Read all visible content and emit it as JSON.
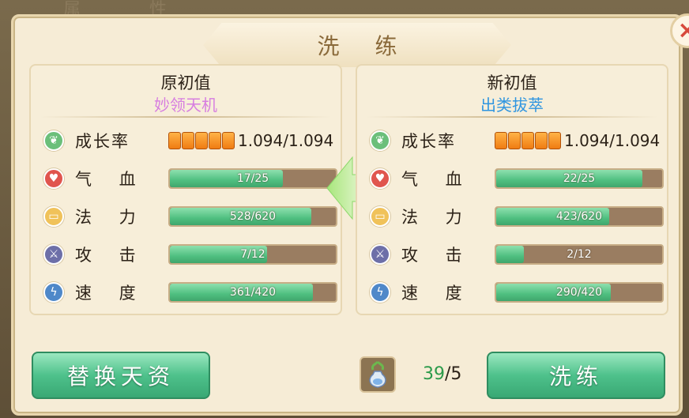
{
  "window": {
    "title": "洗 练",
    "close_icon": "×",
    "bg_text": "属 性"
  },
  "left_card": {
    "title": "原初值",
    "subtitle": "妙领天机",
    "growth": {
      "label": "成长率",
      "value": "1.094/1.094",
      "pips": 5
    },
    "stats": [
      {
        "key": "hp",
        "label": "气 血",
        "text": "17/25",
        "current": 17,
        "max": 25
      },
      {
        "key": "mp",
        "label": "法 力",
        "text": "528/620",
        "current": 528,
        "max": 620
      },
      {
        "key": "atk",
        "label": "攻 击",
        "text": "7/12",
        "current": 7,
        "max": 12
      },
      {
        "key": "spd",
        "label": "速 度",
        "text": "361/420",
        "current": 361,
        "max": 420
      }
    ]
  },
  "right_card": {
    "title": "新初值",
    "subtitle": "出类拔萃",
    "growth": {
      "label": "成长率",
      "value": "1.094/1.094",
      "pips": 5
    },
    "stats": [
      {
        "key": "hp",
        "label": "气 血",
        "text": "22/25",
        "current": 22,
        "max": 25
      },
      {
        "key": "mp",
        "label": "法 力",
        "text": "423/620",
        "current": 423,
        "max": 620
      },
      {
        "key": "atk",
        "label": "攻 击",
        "text": "2/12",
        "current": 2,
        "max": 12
      },
      {
        "key": "spd",
        "label": "速 度",
        "text": "290/420",
        "current": 290,
        "max": 420
      }
    ]
  },
  "footer": {
    "replace_button": "替换天资",
    "wash_button": "洗练",
    "item_count_have": "39",
    "item_count_sep": "/",
    "item_count_need": "5"
  },
  "colors": {
    "growth_icon": "#6bbf7a",
    "hp_icon": "#e0554e",
    "mp_icon": "#f0c25a",
    "atk_icon": "#6d6fa8",
    "spd_icon": "#4f88c9",
    "bar_fill": "#4fbf80",
    "arrow": "#8cd86a"
  }
}
